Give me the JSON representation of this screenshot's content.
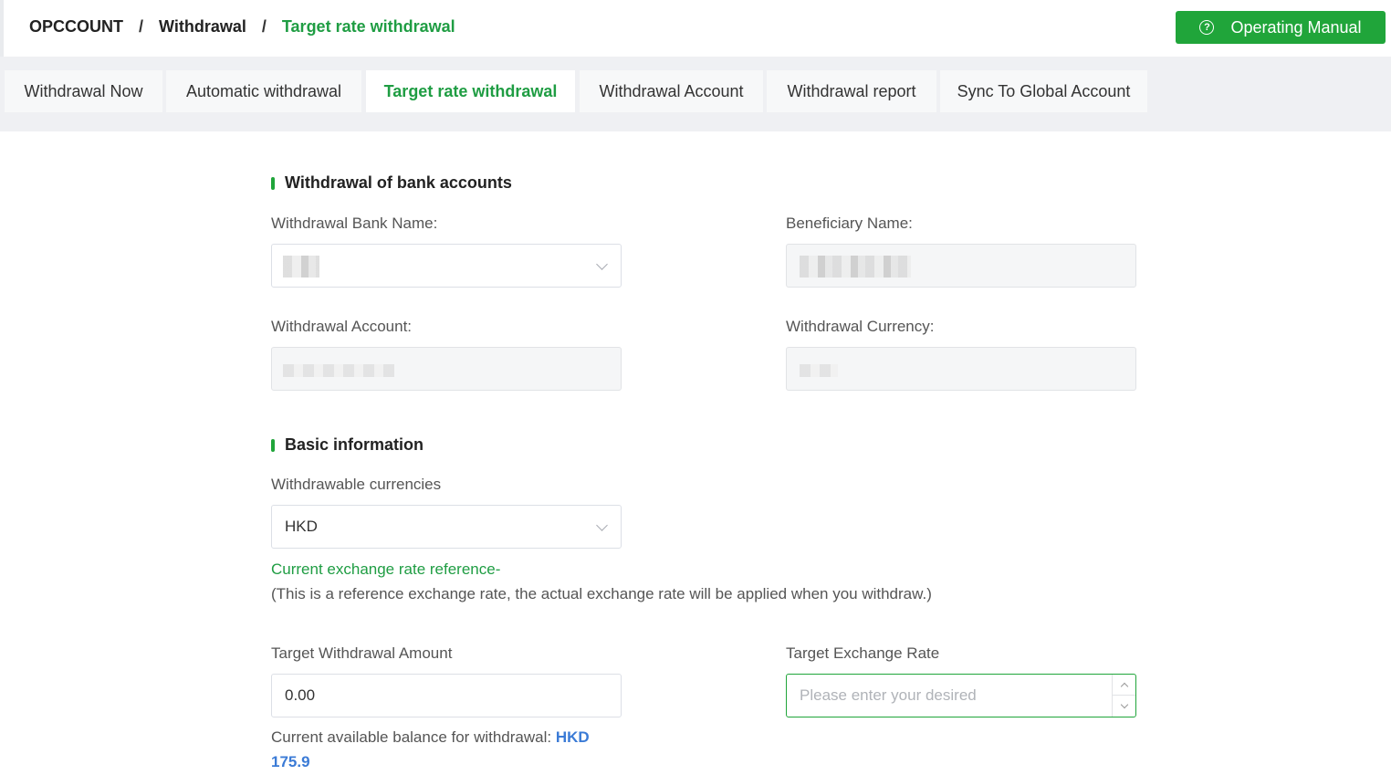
{
  "breadcrumb": {
    "root": "OPCCOUNT",
    "section": "Withdrawal",
    "current": "Target rate withdrawal",
    "separator": "/"
  },
  "header": {
    "manual_button": "Operating Manual",
    "manual_icon": "help-circle-icon"
  },
  "tabs": [
    {
      "label": "Withdrawal Now"
    },
    {
      "label": "Automatic withdrawal"
    },
    {
      "label": "Target rate withdrawal",
      "active": true
    },
    {
      "label": "Withdrawal Account"
    },
    {
      "label": "Withdrawal report"
    },
    {
      "label": "Sync To Global Account"
    }
  ],
  "bank_section": {
    "title": "Withdrawal of bank accounts",
    "bank_name_label": "Withdrawal Bank Name:",
    "beneficiary_label": "Beneficiary Name:",
    "account_label": "Withdrawal Account:",
    "currency_label": "Withdrawal Currency:"
  },
  "basic_section": {
    "title": "Basic information",
    "currencies_label": "Withdrawable currencies",
    "currency_value": "HKD",
    "rate_reference": "Current exchange rate reference-",
    "rate_note": "(This is a reference exchange rate, the actual exchange rate will be applied when you withdraw.)",
    "amount_label": "Target Withdrawal Amount",
    "amount_value": "0.00",
    "rate_label": "Target Exchange Rate",
    "rate_placeholder": "Please enter your desired",
    "balance_prefix": "Current available balance for withdrawal:",
    "balance_currency": "HKD",
    "balance_amount": "175.9"
  },
  "colors": {
    "brand_green": "#20a53a",
    "link_blue": "#3b7bd6"
  }
}
